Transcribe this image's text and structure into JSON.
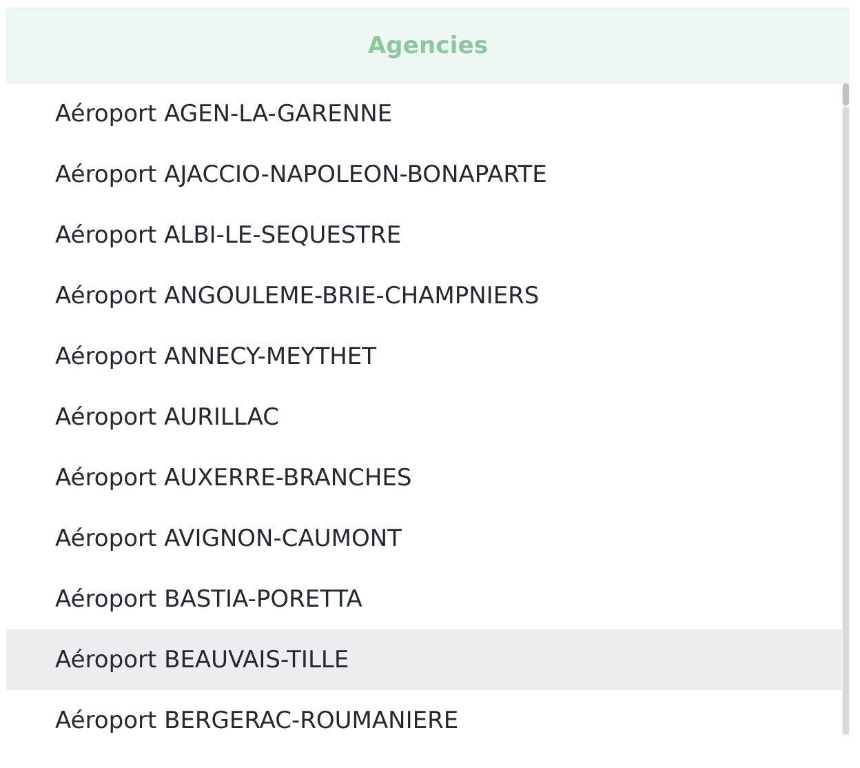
{
  "header": {
    "title": "Agencies"
  },
  "agencies": [
    "Aéroport AGEN-LA-GARENNE",
    "Aéroport AJACCIO-NAPOLEON-BONAPARTE",
    "Aéroport ALBI-LE-SEQUESTRE",
    "Aéroport ANGOULEME-BRIE-CHAMPNIERS",
    "Aéroport ANNECY-MEYTHET",
    "Aéroport AURILLAC",
    "Aéroport AUXERRE-BRANCHES",
    "Aéroport AVIGNON-CAUMONT",
    "Aéroport BASTIA-PORETTA",
    "Aéroport BEAUVAIS-TILLE",
    "Aéroport BERGERAC-ROUMANIERE"
  ],
  "highlighted_item": "Aéroport BEAUVAIS-TILLE",
  "colors": {
    "header_bg": "#eef7f1",
    "header_text": "#8cc79f",
    "item_text": "#242833",
    "highlight_bg": "#ecedef"
  }
}
